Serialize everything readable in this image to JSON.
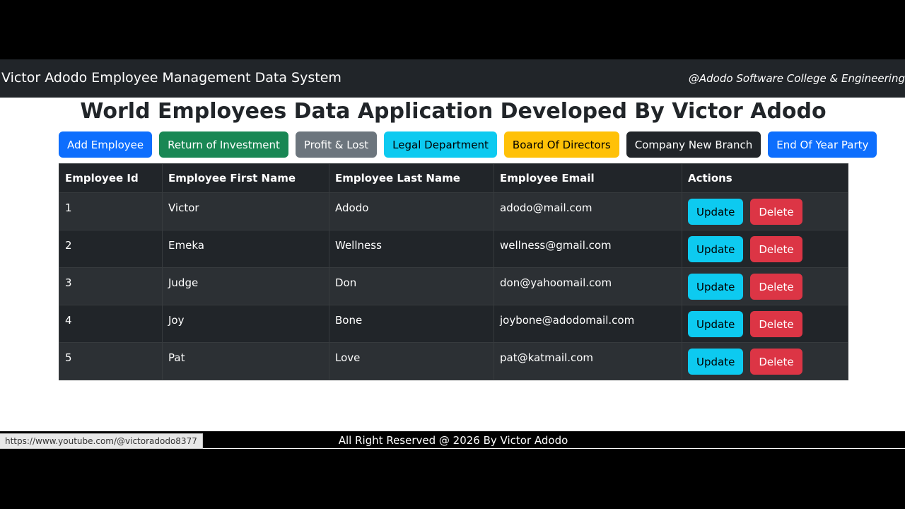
{
  "navbar": {
    "brand": "Victor Adodo Employee Management Data System",
    "right_text": "@Adodo Software College & Engineering"
  },
  "heading": "World Employees Data Application Developed By Victor Adodo",
  "buttons": [
    {
      "label": "Add Employee",
      "color": "#0d6efd"
    },
    {
      "label": "Return of Investment",
      "color": "#198754"
    },
    {
      "label": "Profit & Lost",
      "color": "#6c757d"
    },
    {
      "label": "Legal Department",
      "color": "#0dcaf0"
    },
    {
      "label": "Board Of Directors",
      "color": "#ffc107"
    },
    {
      "label": "Company New Branch",
      "color": "#212529"
    },
    {
      "label": "End Of Year Party",
      "color": "#0d6efd"
    }
  ],
  "table": {
    "headers": [
      "Employee Id",
      "Employee First Name",
      "Employee Last Name",
      "Employee Email",
      "Actions"
    ],
    "rows": [
      {
        "id": "1",
        "first": "Victor",
        "last": "Adodo",
        "email": "adodo@mail.com"
      },
      {
        "id": "2",
        "first": "Emeka",
        "last": "Wellness",
        "email": "wellness@gmail.com"
      },
      {
        "id": "3",
        "first": "Judge",
        "last": "Don",
        "email": "don@yahoomail.com"
      },
      {
        "id": "4",
        "first": "Joy",
        "last": "Bone",
        "email": "joybone@adodomail.com"
      },
      {
        "id": "5",
        "first": "Pat",
        "last": "Love",
        "email": "pat@katmail.com"
      }
    ],
    "update_label": "Update",
    "delete_label": "Delete"
  },
  "footer": {
    "text": "All Right Reserved @ 2026 By Victor Adodo"
  },
  "status_bar": {
    "url": "https://www.youtube.com/@victoradodo8377"
  },
  "colors": {
    "navbar_bg": "#212529",
    "update": "#0dcaf0",
    "delete": "#dc3545"
  }
}
